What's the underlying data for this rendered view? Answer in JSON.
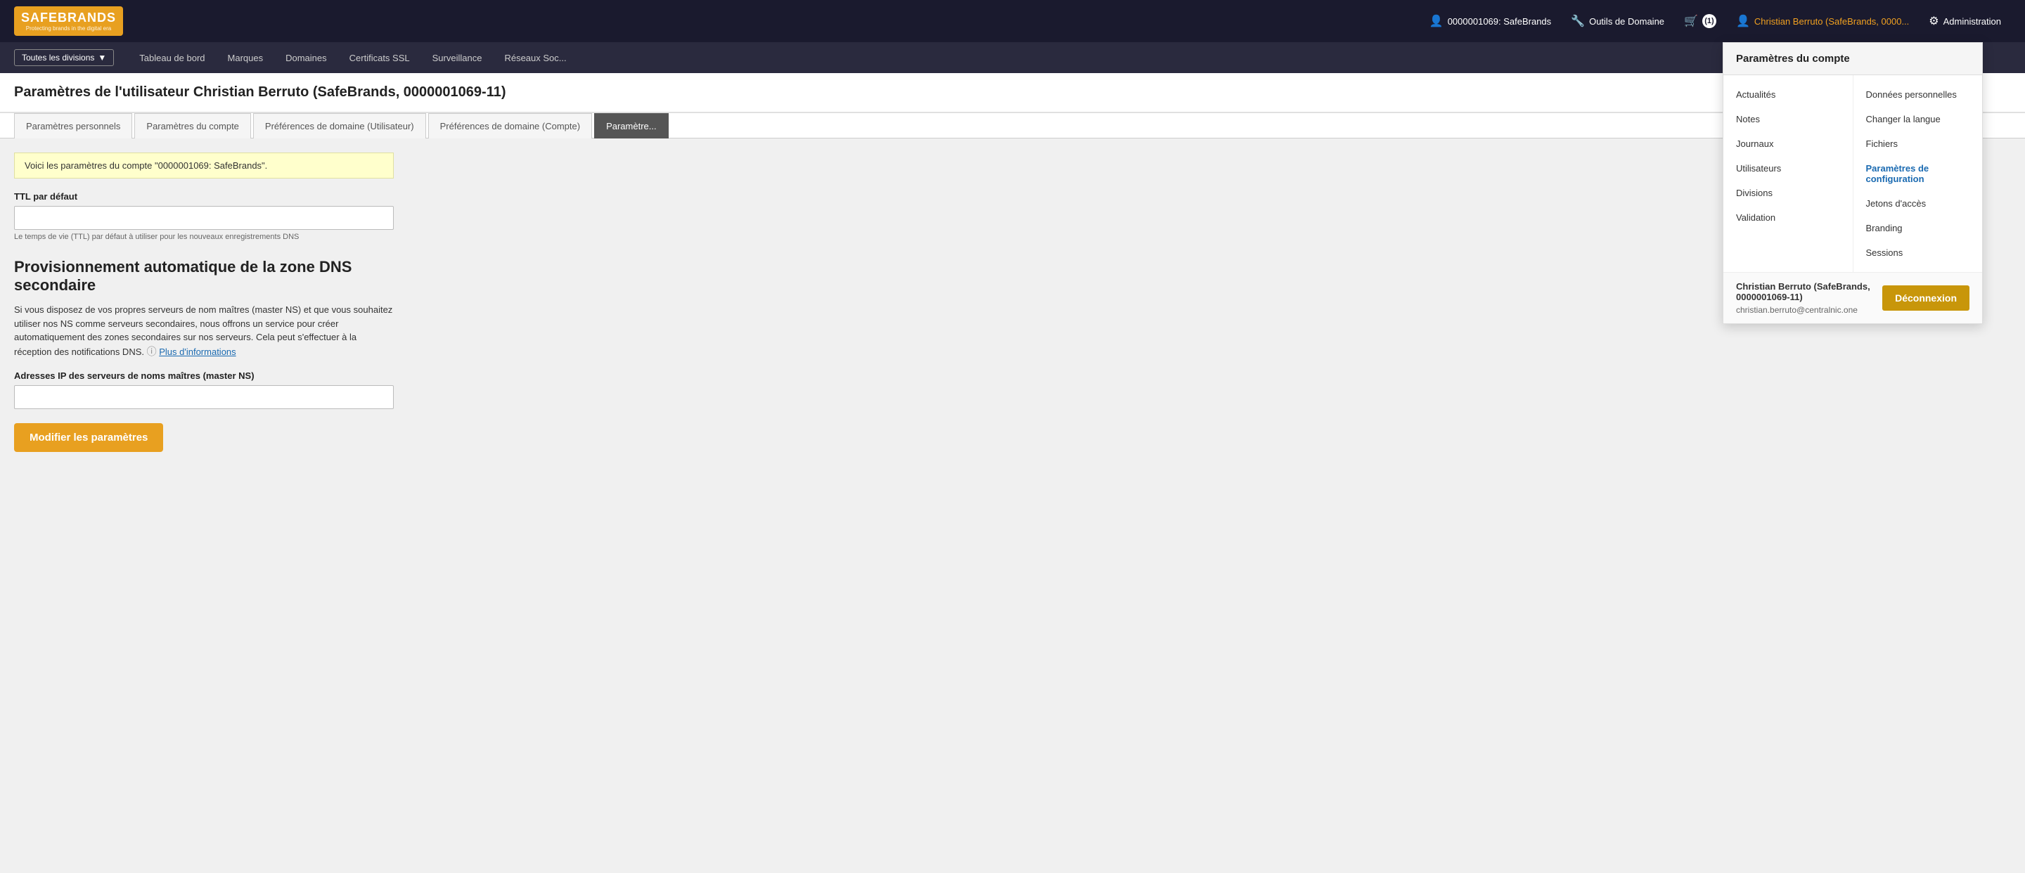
{
  "logo": {
    "title": "SAFEBRANDS",
    "subtitle": "Protecting brands in the digital era"
  },
  "topnav": {
    "account_label": "0000001069: SafeBrands",
    "tools_label": "Outils de Domaine",
    "cart_label": "(1)",
    "user_label": "Christian Berruto (SafeBrands, 0000...",
    "admin_label": "Administration"
  },
  "secnav": {
    "divisions_label": "Toutes les divisions",
    "items": [
      "Tableau de bord",
      "Marques",
      "Domaines",
      "Certificats SSL",
      "Surveillance",
      "Réseaux Soc..."
    ]
  },
  "page": {
    "title": "Paramètres de l'utilisateur Christian Berruto (SafeBrands, 0000001069-11)"
  },
  "tabs": [
    {
      "label": "Paramètres personnels",
      "active": false
    },
    {
      "label": "Paramètres du compte",
      "active": false
    },
    {
      "label": "Préférences de domaine (Utilisateur)",
      "active": false
    },
    {
      "label": "Préférences de domaine (Compte)",
      "active": false
    },
    {
      "label": "Paramètre...",
      "active": true
    }
  ],
  "content": {
    "info_text": "Voici les paramètres du compte \"0000001069: SafeBrands\".",
    "ttl_label": "TTL par défaut",
    "ttl_hint": "Le temps de vie (TTL) par défaut à utiliser pour les nouveaux enregistrements DNS",
    "section_title_line1": "Provisionnement automatique de la zone DNS",
    "section_title_line2": "secondaire",
    "section_desc": "Si vous disposez de vos propres serveurs de nom maîtres (master NS) et que vous souhaitez utiliser nos NS comme serveurs secondaires, nous offrons un service pour créer automatiquement des zones secondaires sur nos serveurs. Cela peut s'effectuer à la réception des notifications DNS.",
    "more_info_label": "Plus d'informations",
    "ip_label": "Adresses IP des serveurs de noms maîtres (master NS)",
    "save_label": "Modifier les paramètres"
  },
  "dropdown": {
    "header": "Paramètres du compte",
    "col1": [
      {
        "label": "Actualités",
        "active": false
      },
      {
        "label": "Notes",
        "active": false
      },
      {
        "label": "Journaux",
        "active": false
      },
      {
        "label": "Utilisateurs",
        "active": false
      },
      {
        "label": "Divisions",
        "active": false
      },
      {
        "label": "Validation",
        "active": false
      }
    ],
    "col2": [
      {
        "label": "Données personnelles",
        "active": false
      },
      {
        "label": "Changer la langue",
        "active": false
      },
      {
        "label": "Fichiers",
        "active": false
      },
      {
        "label": "Paramètres de configuration",
        "active": true
      },
      {
        "label": "Jetons d'accès",
        "active": false
      },
      {
        "label": "Branding",
        "active": false
      },
      {
        "label": "Sessions",
        "active": false
      }
    ],
    "footer_user": "Christian Berruto (SafeBrands, 0000001069-11)",
    "footer_email": "christian.berruto@centralnic.one",
    "logout_label": "Déconnexion"
  }
}
